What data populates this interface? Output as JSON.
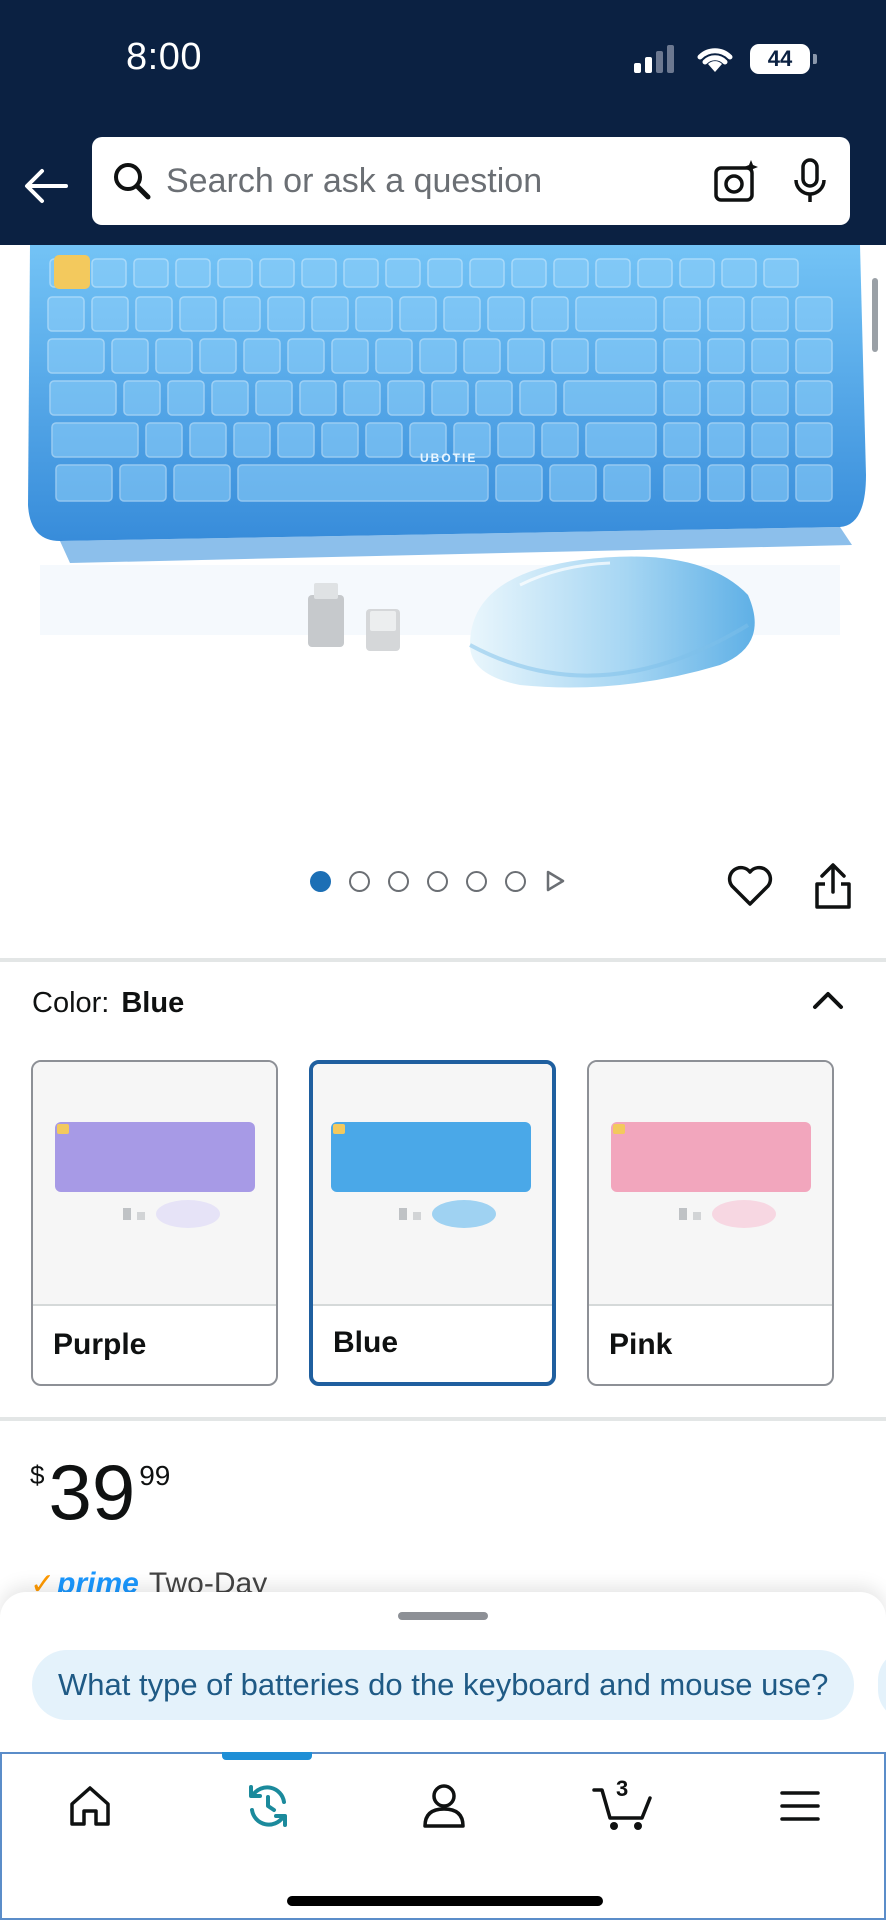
{
  "status_bar": {
    "time": "8:00",
    "battery": "44"
  },
  "search": {
    "placeholder": "Search or ask a question"
  },
  "product": {
    "brand_text": "UBOTIE",
    "carousel": {
      "total": 6,
      "active_index": 0
    }
  },
  "variation": {
    "label": "Color:",
    "selected": "Blue",
    "options": [
      {
        "name": "Purple",
        "color": "#a79ae6"
      },
      {
        "name": "Blue",
        "color": "#4aa8e8"
      },
      {
        "name": "Pink",
        "color": "#f2a6bd"
      }
    ]
  },
  "price": {
    "symbol": "$",
    "whole": "39",
    "fraction": "99"
  },
  "delivery": {
    "prime": "prime",
    "text": "Two-Day"
  },
  "sheet": {
    "suggestion": "What type of batteries do the keyboard and mouse use?"
  },
  "nav": {
    "items": [
      "home",
      "updates",
      "account",
      "cart",
      "menu"
    ],
    "cart_count": "3",
    "active": "updates"
  },
  "colors": {
    "header_bg": "#0b2142",
    "accent_blue": "#1c6fb5",
    "chip_bg": "#e4f2fb",
    "prime_blue": "#1a98ff"
  }
}
